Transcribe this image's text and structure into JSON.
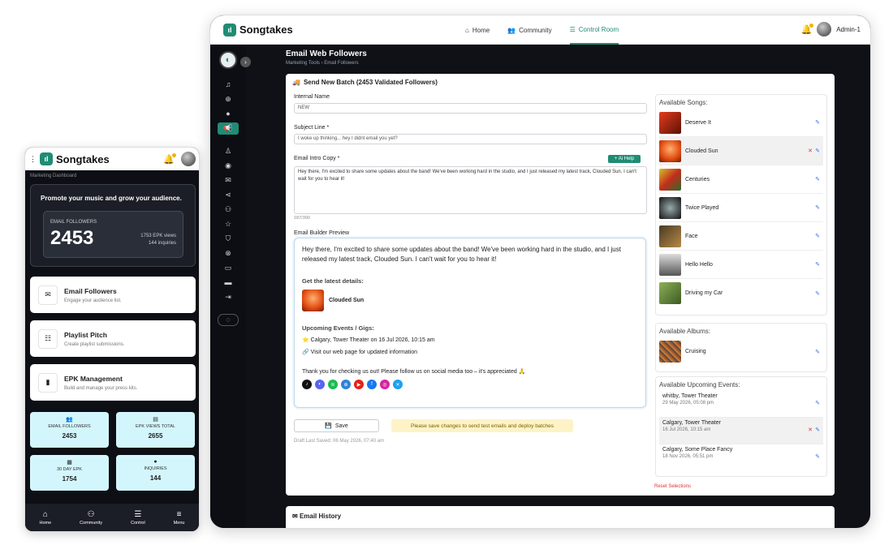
{
  "brand": "Songtakes",
  "desktop": {
    "nav": [
      {
        "label": "Home",
        "icon": "home-icon"
      },
      {
        "label": "Community",
        "icon": "users-icon"
      },
      {
        "label": "Control Room",
        "icon": "sliders-icon"
      }
    ],
    "user": "Admin-1",
    "page_title": "Email Web Followers",
    "breadcrumb": "Marketing Tools › Email Followers",
    "card_title": "Send New Batch (2453 Validated Followers)",
    "internal_name": {
      "label": "Internal Name",
      "value": "NEW"
    },
    "subject": {
      "label": "Subject Line *",
      "value": "I woke up thinking... hey I didnt email you yet?"
    },
    "intro": {
      "label": "Email Intro Copy *",
      "ai_label": "+ Ai Help",
      "value": "Hey there, I'm excited to share some updates about the band! We've been working hard in the studio, and I just released my latest track, Clouded Sun. I can't wait for you to hear it!",
      "count": "187/300"
    },
    "preview": {
      "label": "Email Builder Preview",
      "intro": "Hey there, I'm excited to share some updates about the band! We've been working hard in the studio, and I just released my latest track, Clouded Sun. I can't wait for you to hear it!",
      "details_heading": "Get the latest details:",
      "song": "Clouded Sun",
      "events_heading": "Upcoming Events / Gigs:",
      "event": "⭐ Calgary, Tower Theater on 16 Jul 2026, 10:15 am",
      "link": "🔗 Visit our web page for updated information",
      "thanks": "Thank you for checking us out! Please follow us on social media too – it's appreciated 🙏"
    },
    "save_label": "Save",
    "warning": "Please save changes to send test emails and deploy batches",
    "draft": "Draft Last Saved: 06 May 2026, 07:40 am",
    "songs_title": "Available Songs:",
    "songs": [
      "Deserve It",
      "Clouded Sun",
      "Centuries",
      "Twice Played",
      "Face",
      "Hello Hello",
      "Driving my Car"
    ],
    "albums_title": "Available Albums:",
    "albums": [
      "Cruising"
    ],
    "events_title": "Available Upcoming Events:",
    "events": [
      {
        "name": "whitby, Tower Theater",
        "date": "29 May 2026, 05:08 pm"
      },
      {
        "name": "Calgary, Tower Theater",
        "date": "16 Jul 2026, 10:15 am"
      },
      {
        "name": "Calgary, Some Place Fancy",
        "date": "18 Nov 2026, 05:51 pm"
      }
    ],
    "reset": "Reset Selections",
    "history": "Email History"
  },
  "mobile": {
    "crumb": "Marketing Dashboard",
    "hero_title": "Promote your music and grow your audience.",
    "followers_label": "EMAIL FOLLOWERS",
    "followers_value": "2453",
    "epk_views": "1753 EPK views",
    "inquiries": "144 inquiries",
    "cards": [
      {
        "title": "Email Followers",
        "sub": "Engage your audience list."
      },
      {
        "title": "Playlist Pitch",
        "sub": "Create playlist submissions."
      },
      {
        "title": "EPK Management",
        "sub": "Build and manage your press kits."
      }
    ],
    "stats": [
      {
        "label": "EMAIL FOLLOWERS",
        "value": "2453"
      },
      {
        "label": "EPK VIEWS TOTAL",
        "value": "2655"
      },
      {
        "label": "30 DAY EPK",
        "value": "1754"
      },
      {
        "label": "INQUIRIES",
        "value": "144"
      }
    ],
    "nav": [
      "Home",
      "Community",
      "Control",
      "Menu"
    ]
  }
}
